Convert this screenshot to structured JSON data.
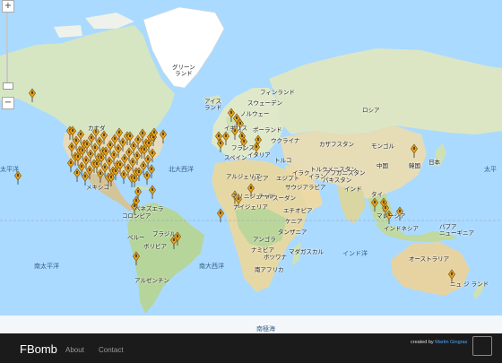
{
  "map": {
    "labels": {
      "greenland": "グリーン\nランド",
      "iceland": "アイス\nランド",
      "finland": "フィンランド",
      "sweden": "スウェーデン",
      "norway": "ノルウェー",
      "russia": "ロシア",
      "canada": "カナダ",
      "britain": "イギリス",
      "poland": "ポーランド",
      "france": "フランス",
      "ukraine": "ウクライナ",
      "spain": "スペイン",
      "italy": "イタリア",
      "kazakhstan": "カザフスタン",
      "mongolia": "モンゴル",
      "turkey": "トルコ",
      "turkmenistan": "トルクメニスタン",
      "china": "中国",
      "japan": "日本",
      "korea": "韓国",
      "iraq": "イラク",
      "iran": "イラン",
      "afghanistan": "アフガニスタン",
      "pakistan": "パキスタン",
      "india": "インド",
      "algeria": "アルジェリア",
      "libya": "リビア",
      "egypt": "エジプト",
      "saudi": "サウジアラビア",
      "mexico": "メキシコ",
      "mali": "マリ",
      "niger": "ニジェール",
      "chad": "チャド",
      "sudan": "スーダン",
      "nigeria": "ナイジェリア",
      "ethiopia": "エチオピア",
      "kenya": "ケニア",
      "tanzania": "タンザニア",
      "thailand": "タイ",
      "malaysia": "マレーシア",
      "indonesia": "インドネシア",
      "papua": "パプア\nニューギニア",
      "venezuela": "ベネズエラ",
      "colombia": "コロンビア",
      "peru": "ペルー",
      "brazil": "ブラジル",
      "bolivia": "ボリビア",
      "angola": "アンゴラ",
      "namibia": "ナミビア",
      "botswana": "ボツワナ",
      "madagascar": "マダガスカル",
      "south_africa": "南アフリカ",
      "australia": "オーストラリア",
      "new_zealand": "ニュ ジ ランド",
      "argentina": "アルゼンチン",
      "north_atlantic": "北大西洋",
      "south_atlantic": "南大西洋",
      "south_pacific": "南太平洋",
      "indian_ocean": "インド洋",
      "pacific_left": "太平洋",
      "pacific_right": "太平",
      "southern_ocean": "南極海"
    },
    "zoom": {
      "in": "+",
      "out": "−"
    }
  },
  "footer": {
    "brand": "FBomb",
    "nav": [
      "About",
      "Contact"
    ],
    "credit_prefix": "created by ",
    "credit_name": "Martin Gingras"
  }
}
